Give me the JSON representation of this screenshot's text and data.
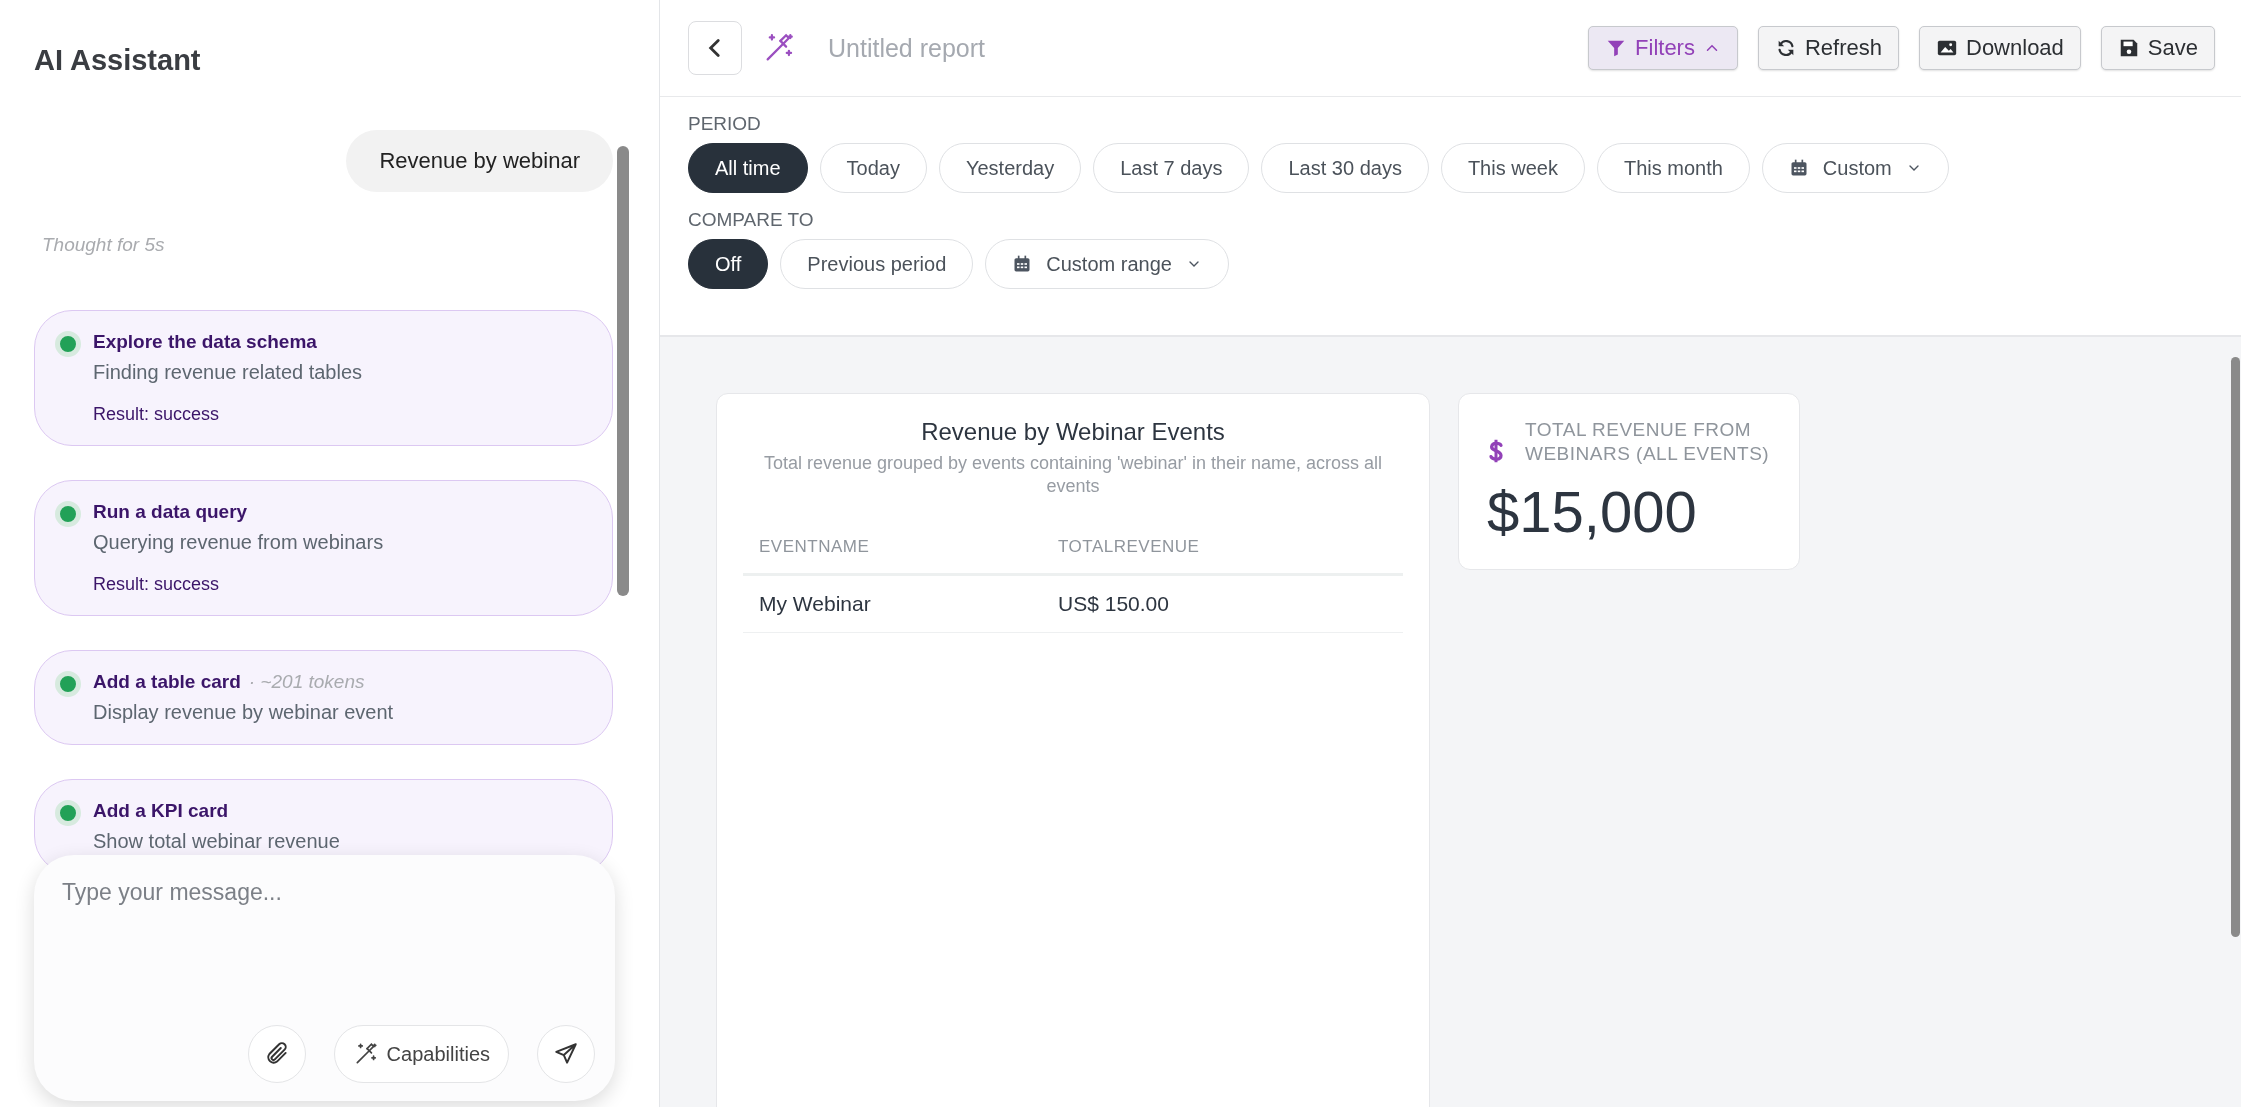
{
  "assistant": {
    "title": "AI Assistant",
    "messages": [
      {
        "kind": "user",
        "text": "Revenue by webinar"
      },
      {
        "kind": "thought",
        "text": "Thought for 5s"
      },
      {
        "kind": "step",
        "done": true,
        "title": "Explore the data schema",
        "description": "Finding revenue related tables",
        "result": "Result: success"
      },
      {
        "kind": "step",
        "done": true,
        "title": "Run a data query",
        "description": "Querying revenue from webinars",
        "result": "Result: success"
      },
      {
        "kind": "step",
        "done": true,
        "title": "Add a table card",
        "tokens": "· ~201 tokens",
        "description": "Display revenue by webinar event"
      },
      {
        "kind": "step",
        "done": true,
        "title": "Add a KPI card",
        "description": "Show total webinar revenue"
      }
    ],
    "composer": {
      "placeholder": "Type your message...",
      "capabilities": "Capabilities"
    }
  },
  "report": {
    "title": "Untitled report",
    "actions": [
      {
        "kind": "filters",
        "label": "Filters",
        "expanded": true
      },
      {
        "kind": "refresh",
        "label": "Refresh"
      },
      {
        "kind": "download",
        "label": "Download"
      },
      {
        "kind": "save",
        "label": "Save"
      }
    ],
    "period": {
      "label": "PERIOD",
      "options": [
        {
          "label": "All time",
          "selected": true
        },
        {
          "label": "Today",
          "selected": false
        },
        {
          "label": "Yesterday",
          "selected": false
        },
        {
          "label": "Last 7 days",
          "selected": false
        },
        {
          "label": "Last 30 days",
          "selected": false
        },
        {
          "label": "This week",
          "selected": false
        },
        {
          "label": "This month",
          "selected": false
        },
        {
          "label": "Custom",
          "selected": false,
          "kind": "dropdown"
        }
      ]
    },
    "compare": {
      "label": "COMPARE TO",
      "options": [
        {
          "label": "Off",
          "selected": true
        },
        {
          "label": "Previous period",
          "selected": false
        },
        {
          "label": "Custom range",
          "selected": false,
          "kind": "dropdown"
        }
      ]
    },
    "table_card": {
      "title": "Revenue by Webinar Events",
      "subtitle": "Total revenue grouped by events containing 'webinar' in their name, across all events",
      "columns": [
        "EVENTNAME",
        "TOTALREVENUE"
      ],
      "rows": [
        [
          "My Webinar",
          "US$ 150.00"
        ]
      ]
    },
    "kpi_card": {
      "label": "TOTAL REVENUE FROM WEBINARS (ALL EVENTS)",
      "value": "$15,000"
    }
  }
}
